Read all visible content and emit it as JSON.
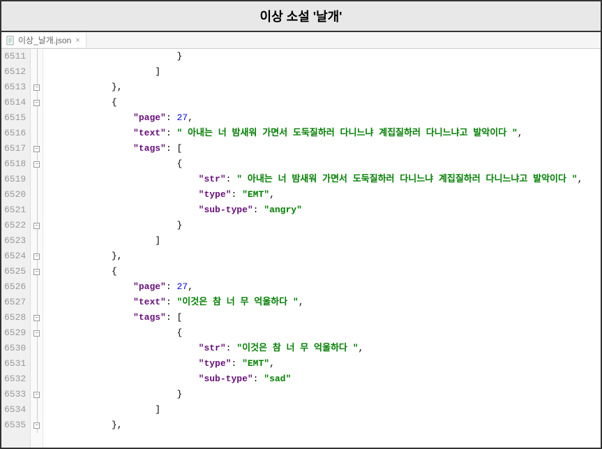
{
  "header": {
    "title": "이상 소설 '날개'"
  },
  "tab": {
    "filename": "이상_날개.json",
    "close": "×"
  },
  "gutter": {
    "start": 6511,
    "count": 25
  },
  "code": {
    "lines": [
      {
        "indent": 24,
        "tokens": [
          {
            "t": "punct",
            "v": "}"
          }
        ]
      },
      {
        "indent": 20,
        "tokens": [
          {
            "t": "punct",
            "v": "]"
          }
        ]
      },
      {
        "indent": 12,
        "tokens": [
          {
            "t": "punct",
            "v": "},"
          }
        ]
      },
      {
        "indent": 12,
        "tokens": [
          {
            "t": "punct",
            "v": "{"
          }
        ]
      },
      {
        "indent": 16,
        "tokens": [
          {
            "t": "key",
            "v": "\"page\""
          },
          {
            "t": "punct",
            "v": ": "
          },
          {
            "t": "num",
            "v": "27"
          },
          {
            "t": "punct",
            "v": ","
          }
        ]
      },
      {
        "indent": 16,
        "tokens": [
          {
            "t": "key",
            "v": "\"text\""
          },
          {
            "t": "punct",
            "v": ": "
          },
          {
            "t": "str",
            "v": "\" 아내는 너 밤새워 가면서 도둑질하러 다니느냐 계집질하러 다니느냐고 발악이다 \""
          },
          {
            "t": "punct",
            "v": ","
          }
        ]
      },
      {
        "indent": 16,
        "tokens": [
          {
            "t": "key",
            "v": "\"tags\""
          },
          {
            "t": "punct",
            "v": ": ["
          }
        ]
      },
      {
        "indent": 24,
        "tokens": [
          {
            "t": "punct",
            "v": "{"
          }
        ]
      },
      {
        "indent": 28,
        "tokens": [
          {
            "t": "key",
            "v": "\"str\""
          },
          {
            "t": "punct",
            "v": ": "
          },
          {
            "t": "str",
            "v": "\" 아내는 너 밤새워 가면서 도둑질하러 다니느냐 계집질하러 다니느냐고 발악이다 \""
          },
          {
            "t": "punct",
            "v": ","
          }
        ]
      },
      {
        "indent": 28,
        "tokens": [
          {
            "t": "key",
            "v": "\"type\""
          },
          {
            "t": "punct",
            "v": ": "
          },
          {
            "t": "str",
            "v": "\"EMT\""
          },
          {
            "t": "punct",
            "v": ","
          }
        ]
      },
      {
        "indent": 28,
        "tokens": [
          {
            "t": "key",
            "v": "\"sub-type\""
          },
          {
            "t": "punct",
            "v": ": "
          },
          {
            "t": "str",
            "v": "\"angry\""
          }
        ]
      },
      {
        "indent": 24,
        "tokens": [
          {
            "t": "punct",
            "v": "}"
          }
        ]
      },
      {
        "indent": 20,
        "tokens": [
          {
            "t": "punct",
            "v": "]"
          }
        ]
      },
      {
        "indent": 12,
        "tokens": [
          {
            "t": "punct",
            "v": "},"
          }
        ]
      },
      {
        "indent": 12,
        "tokens": [
          {
            "t": "punct",
            "v": "{"
          }
        ]
      },
      {
        "indent": 16,
        "tokens": [
          {
            "t": "key",
            "v": "\"page\""
          },
          {
            "t": "punct",
            "v": ": "
          },
          {
            "t": "num",
            "v": "27"
          },
          {
            "t": "punct",
            "v": ","
          }
        ]
      },
      {
        "indent": 16,
        "tokens": [
          {
            "t": "key",
            "v": "\"text\""
          },
          {
            "t": "punct",
            "v": ": "
          },
          {
            "t": "str",
            "v": "\"이것은 참 너 무 억울하다 \""
          },
          {
            "t": "punct",
            "v": ","
          }
        ]
      },
      {
        "indent": 16,
        "tokens": [
          {
            "t": "key",
            "v": "\"tags\""
          },
          {
            "t": "punct",
            "v": ": ["
          }
        ]
      },
      {
        "indent": 24,
        "tokens": [
          {
            "t": "punct",
            "v": "{"
          }
        ]
      },
      {
        "indent": 28,
        "tokens": [
          {
            "t": "key",
            "v": "\"str\""
          },
          {
            "t": "punct",
            "v": ": "
          },
          {
            "t": "str",
            "v": "\"이것은 참 너 무 억울하다 \""
          },
          {
            "t": "punct",
            "v": ","
          }
        ]
      },
      {
        "indent": 28,
        "tokens": [
          {
            "t": "key",
            "v": "\"type\""
          },
          {
            "t": "punct",
            "v": ": "
          },
          {
            "t": "str",
            "v": "\"EMT\""
          },
          {
            "t": "punct",
            "v": ","
          }
        ]
      },
      {
        "indent": 28,
        "tokens": [
          {
            "t": "key",
            "v": "\"sub-type\""
          },
          {
            "t": "punct",
            "v": ": "
          },
          {
            "t": "str",
            "v": "\"sad\""
          }
        ]
      },
      {
        "indent": 24,
        "tokens": [
          {
            "t": "punct",
            "v": "}"
          }
        ]
      },
      {
        "indent": 20,
        "tokens": [
          {
            "t": "punct",
            "v": "]"
          }
        ]
      },
      {
        "indent": 12,
        "tokens": [
          {
            "t": "punct",
            "v": "},"
          }
        ]
      }
    ]
  },
  "fold": {
    "markers": {
      "0": "line",
      "1": "line",
      "2": "box-end",
      "3": "box-start",
      "4": "line",
      "5": "line",
      "6": "box-start",
      "7": "box-start",
      "8": "line",
      "9": "line",
      "10": "line",
      "11": "box-end",
      "12": "line",
      "13": "box-end",
      "14": "box-start",
      "15": "line",
      "16": "line",
      "17": "box-start",
      "18": "box-start",
      "19": "line",
      "20": "line",
      "21": "line",
      "22": "box-end",
      "23": "line",
      "24": "box-end"
    }
  }
}
